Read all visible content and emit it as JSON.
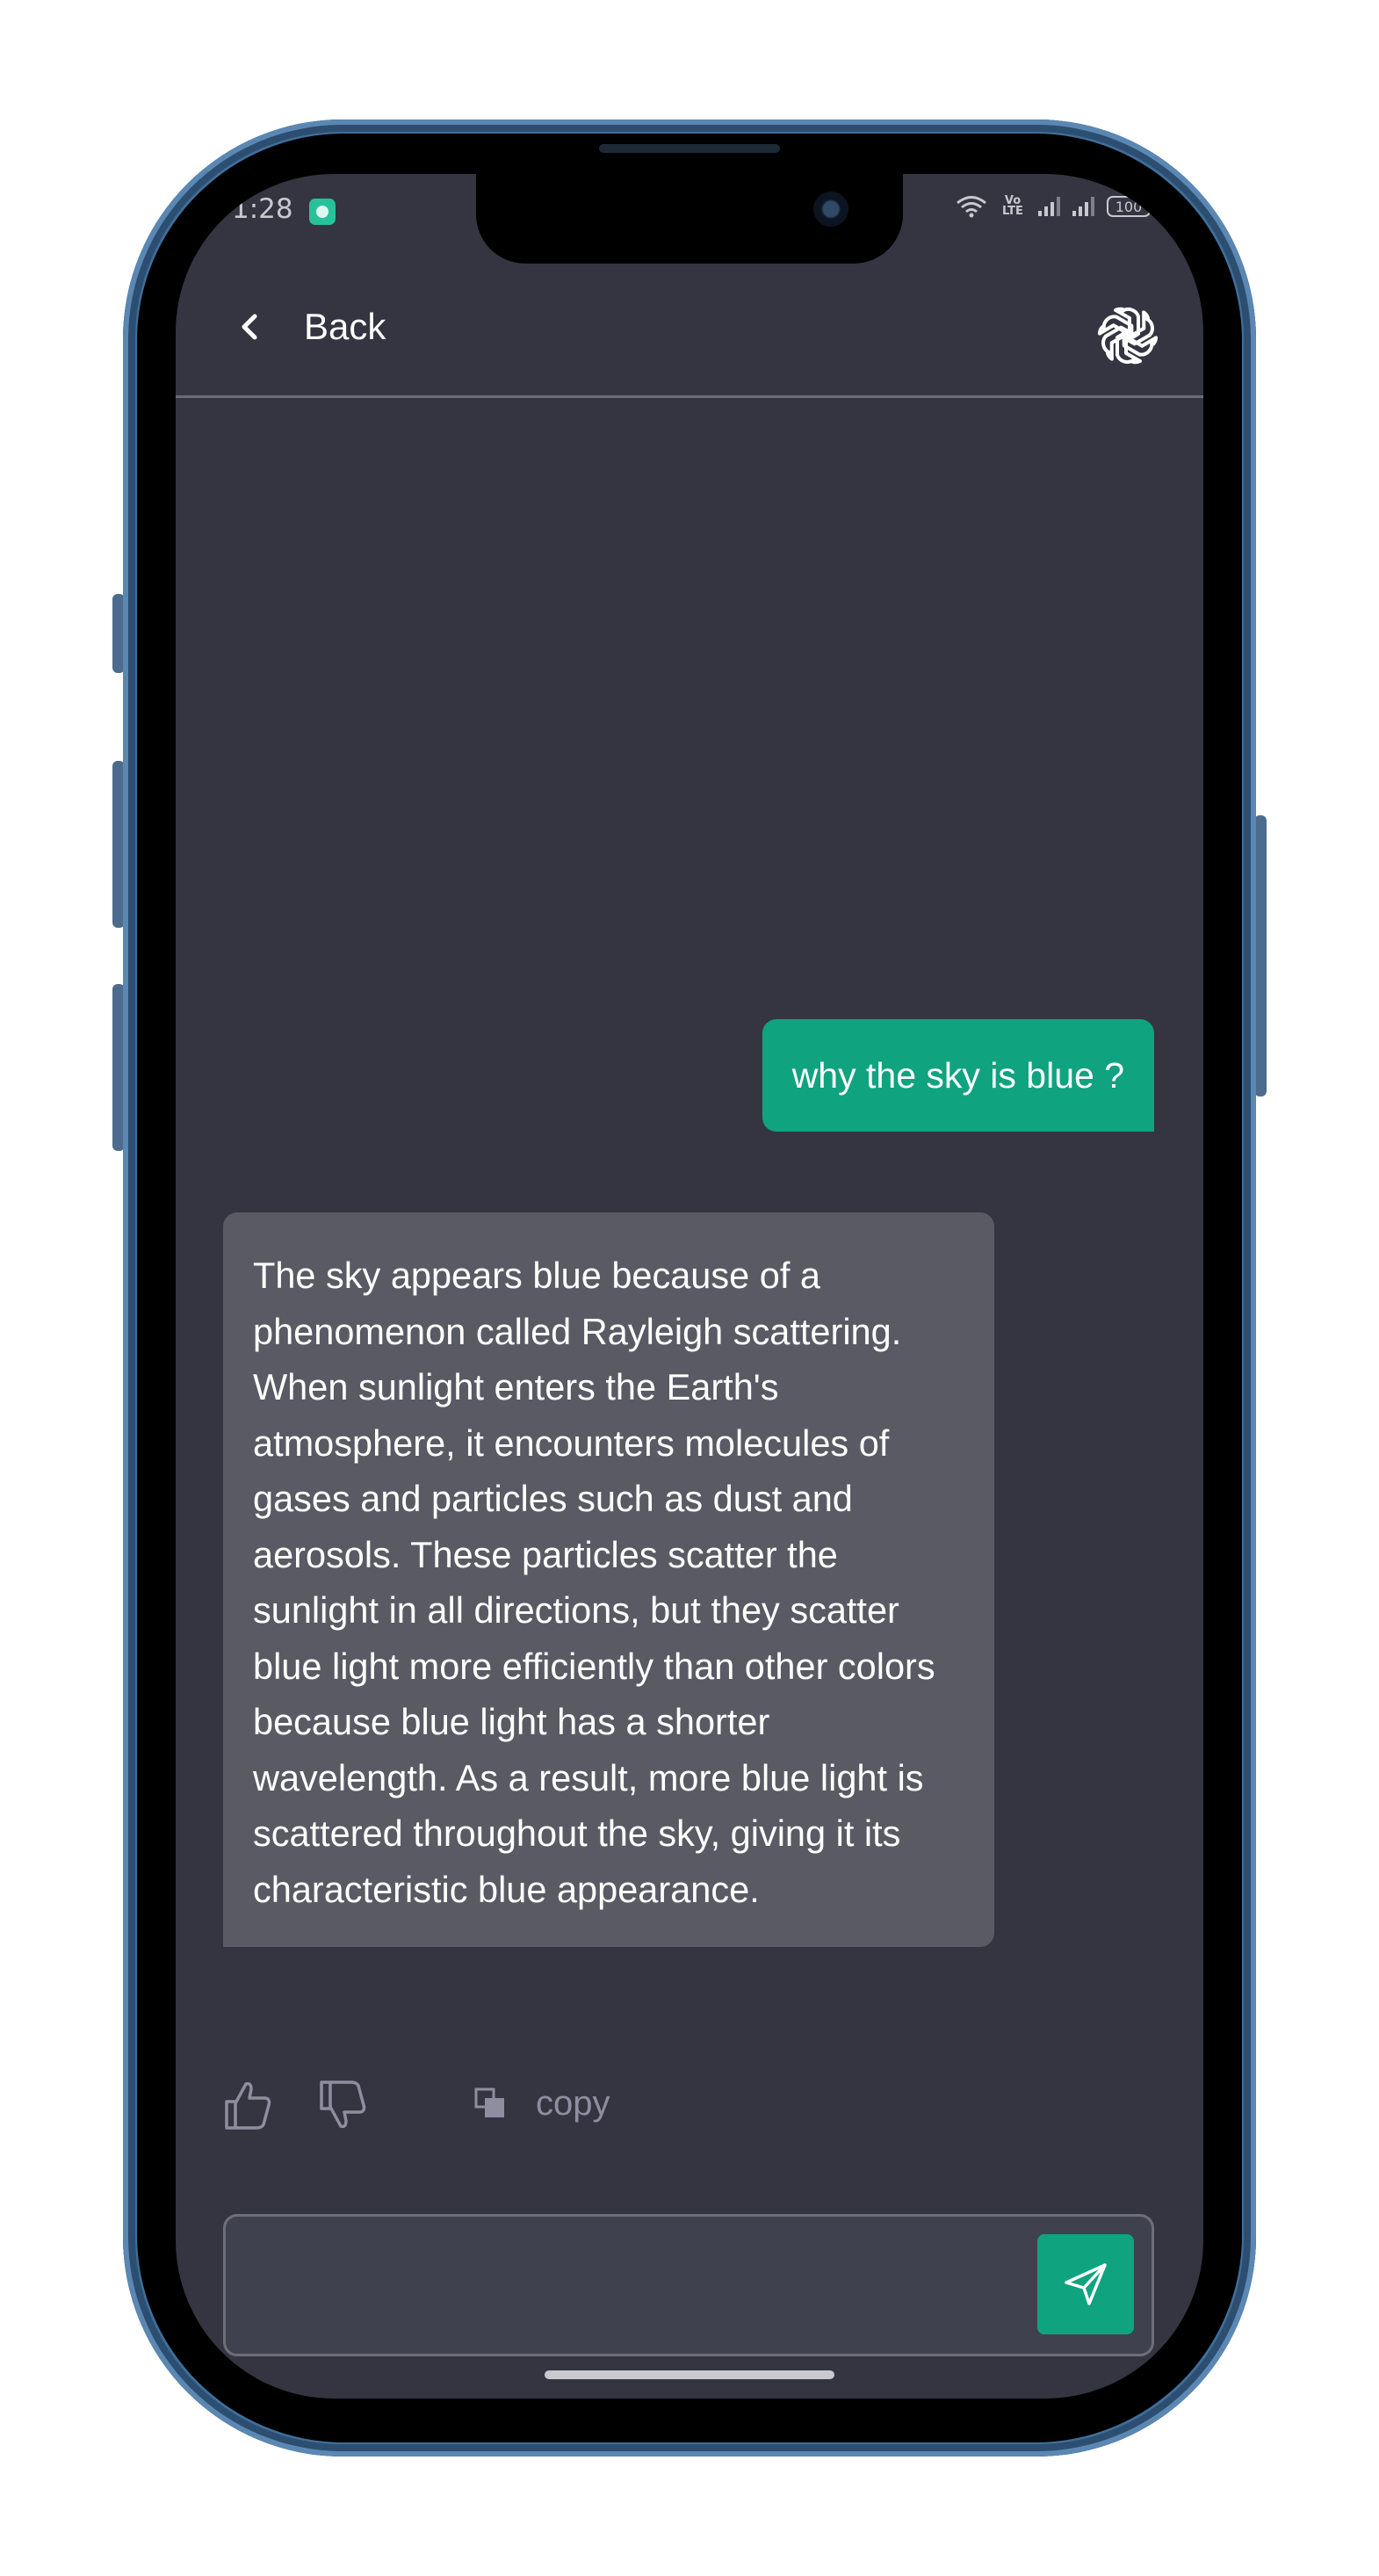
{
  "status_bar": {
    "time": "1:28",
    "volte": "Vo LTE",
    "battery": "100"
  },
  "header": {
    "back_label": "Back",
    "logo_icon": "openai-logo-icon"
  },
  "messages": {
    "user": "why the sky is blue ?",
    "assistant": "The sky appears blue because of a phenomenon called Rayleigh scattering. When sunlight enters the Earth's atmosphere, it encounters molecules of gases and particles such as dust and aerosols. These particles scatter the sunlight in all directions, but they scatter blue light more efficiently than other colors because blue light has a shorter wavelength. As a result, more blue light is scattered throughout the sky, giving it its characteristic blue appearance."
  },
  "actions": {
    "like_icon": "thumbs-up-icon",
    "dislike_icon": "thumbs-down-icon",
    "copy_icon": "copy-icon",
    "copy_label": "copy"
  },
  "composer": {
    "value": "",
    "send_icon": "send-icon"
  },
  "colors": {
    "background": "#343541",
    "user_bubble": "#10a37f",
    "assistant_bubble": "#5a5a64",
    "accent": "#10a37f",
    "frame": "#3f6f9b"
  }
}
